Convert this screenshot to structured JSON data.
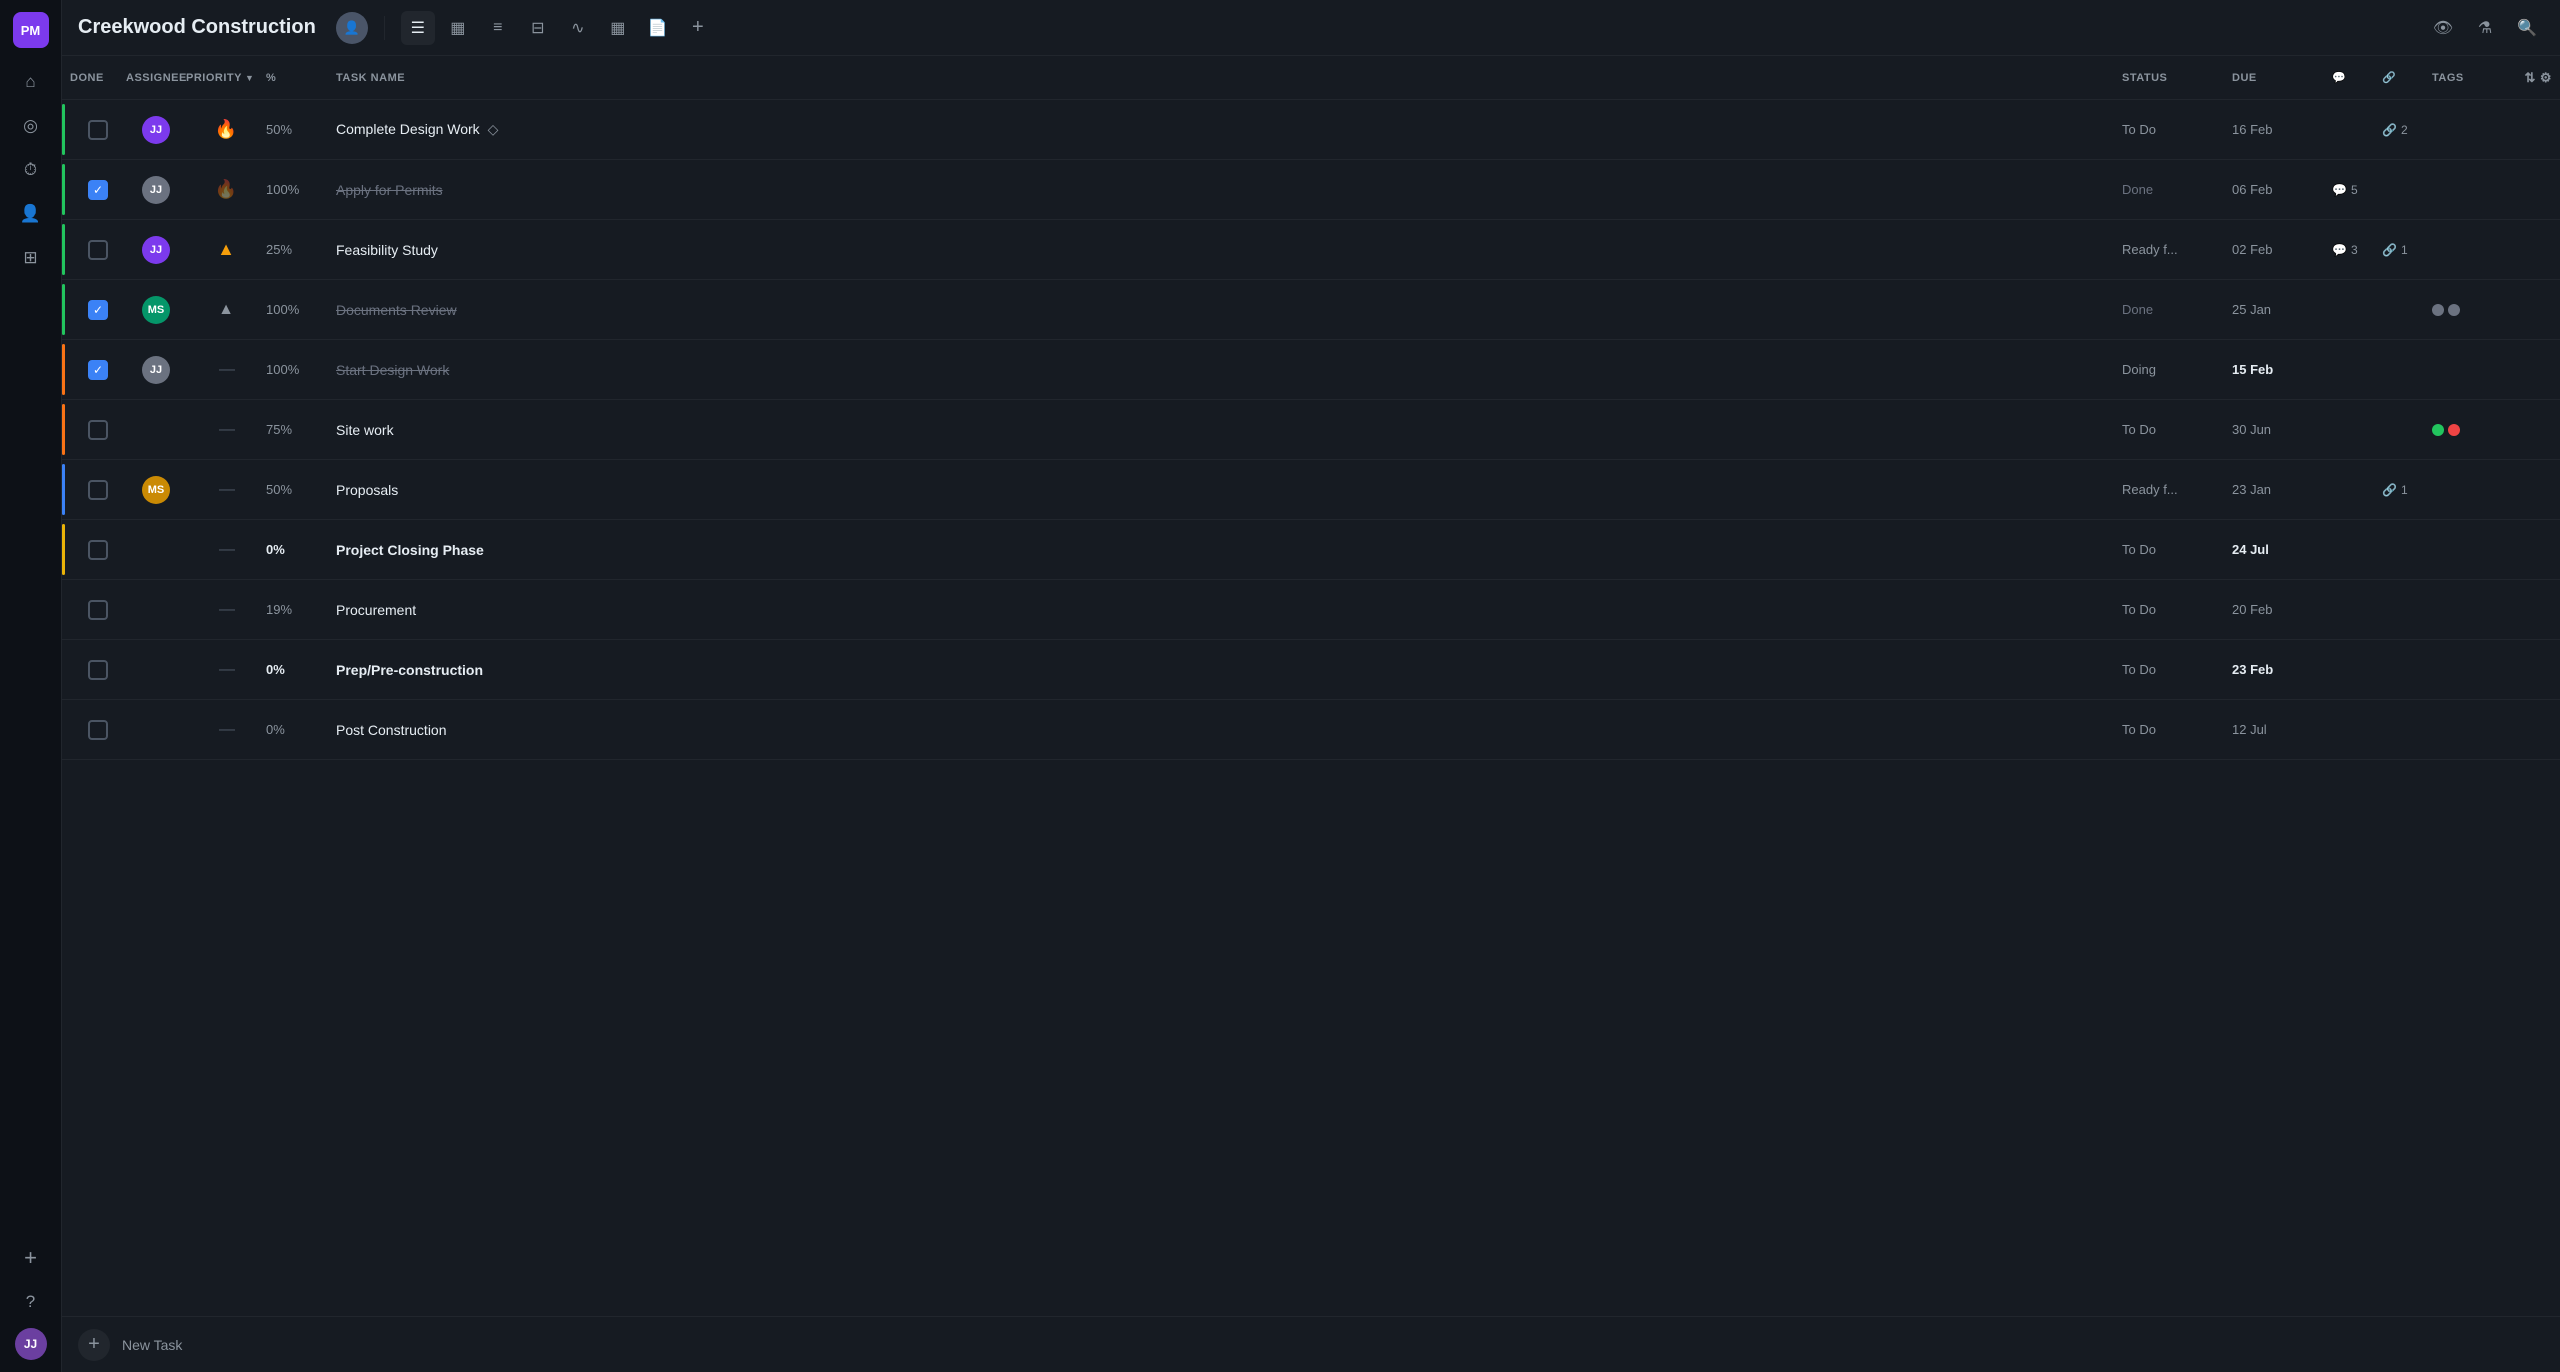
{
  "app": {
    "logo": "PM",
    "title": "Creekwood Construction"
  },
  "sidebar": {
    "icons": [
      {
        "name": "home-icon",
        "symbol": "⌂"
      },
      {
        "name": "notification-icon",
        "symbol": "🔔"
      },
      {
        "name": "clock-icon",
        "symbol": "⏱"
      },
      {
        "name": "people-icon",
        "symbol": "👥"
      },
      {
        "name": "briefcase-icon",
        "symbol": "💼"
      }
    ],
    "bottom_icons": [
      {
        "name": "add-icon",
        "symbol": "+"
      },
      {
        "name": "help-icon",
        "symbol": "?"
      }
    ],
    "user_initials": "JJ"
  },
  "toolbar": {
    "tools": [
      {
        "name": "list-view-btn",
        "symbol": "≡",
        "active": true
      },
      {
        "name": "bar-chart-btn",
        "symbol": "▦",
        "active": false
      },
      {
        "name": "menu-btn",
        "symbol": "≡",
        "active": false
      },
      {
        "name": "table-btn",
        "symbol": "⊞",
        "active": false
      },
      {
        "name": "wave-btn",
        "symbol": "∿",
        "active": false
      },
      {
        "name": "calendar-btn",
        "symbol": "📅",
        "active": false
      },
      {
        "name": "doc-btn",
        "symbol": "📄",
        "active": false
      },
      {
        "name": "plus-btn",
        "symbol": "+",
        "active": false
      }
    ],
    "right_tools": [
      {
        "name": "eye-btn",
        "symbol": "👁"
      },
      {
        "name": "filter-btn",
        "symbol": "⚗"
      },
      {
        "name": "search-btn",
        "symbol": "🔍"
      }
    ]
  },
  "columns": {
    "done": "DONE",
    "assignee": "ASSIGNEE",
    "priority": "PRIORITY",
    "percent": "%",
    "task_name": "TASK NAME",
    "status": "STATUS",
    "due": "DUE",
    "comments": "",
    "links": "",
    "tags": "TAGS"
  },
  "tasks": [
    {
      "id": 1,
      "done": false,
      "assignee": "JJ",
      "assignee_color": "#7c3aed",
      "priority": "fire",
      "percent": "50%",
      "percent_bold": false,
      "task_name": "Complete Design Work",
      "task_name_done": false,
      "task_name_bold": false,
      "has_diamond": true,
      "status": "To Do",
      "status_done": false,
      "due": "16 Feb",
      "due_bold": false,
      "comments": "",
      "links": "2",
      "tags": [],
      "accent": "green"
    },
    {
      "id": 2,
      "done": true,
      "assignee": "JJ",
      "assignee_color": "#6b7280",
      "priority": "fire_dim",
      "percent": "100%",
      "percent_bold": false,
      "task_name": "Apply for Permits",
      "task_name_done": true,
      "task_name_bold": false,
      "has_diamond": false,
      "status": "Done",
      "status_done": true,
      "due": "06 Feb",
      "due_bold": false,
      "comments": "5",
      "links": "",
      "tags": [],
      "accent": "green"
    },
    {
      "id": 3,
      "done": false,
      "assignee": "JJ",
      "assignee_color": "#7c3aed",
      "priority": "up",
      "percent": "25%",
      "percent_bold": false,
      "task_name": "Feasibility Study",
      "task_name_done": false,
      "task_name_bold": false,
      "has_diamond": false,
      "status": "Ready f...",
      "status_done": false,
      "due": "02 Feb",
      "due_bold": false,
      "comments": "3",
      "links": "1",
      "tags": [],
      "accent": "green"
    },
    {
      "id": 4,
      "done": true,
      "assignee": "MS",
      "assignee_color": "#059669",
      "priority": "medium",
      "percent": "100%",
      "percent_bold": false,
      "task_name": "Documents Review",
      "task_name_done": true,
      "task_name_bold": false,
      "has_diamond": false,
      "status": "Done",
      "status_done": true,
      "due": "25 Jan",
      "due_bold": false,
      "comments": "",
      "links": "",
      "tags": [
        "#6b7280",
        "#6b7280"
      ],
      "accent": "green"
    },
    {
      "id": 5,
      "done": true,
      "assignee": "JJ",
      "assignee_color": "#6b7280",
      "priority": "low",
      "percent": "100%",
      "percent_bold": false,
      "task_name": "Start Design Work",
      "task_name_done": true,
      "task_name_bold": false,
      "has_diamond": false,
      "status": "Doing",
      "status_done": false,
      "due": "15 Feb",
      "due_bold": true,
      "comments": "",
      "links": "",
      "tags": [],
      "accent": "orange"
    },
    {
      "id": 6,
      "done": false,
      "assignee": "",
      "assignee_color": "",
      "priority": "low",
      "percent": "75%",
      "percent_bold": false,
      "task_name": "Site work",
      "task_name_done": false,
      "task_name_bold": false,
      "has_diamond": false,
      "status": "To Do",
      "status_done": false,
      "due": "30 Jun",
      "due_bold": false,
      "comments": "",
      "links": "",
      "tags": [
        "#22c55e",
        "#ef4444"
      ],
      "accent": "orange"
    },
    {
      "id": 7,
      "done": false,
      "assignee": "MS",
      "assignee_color": "#ca8a04",
      "priority": "low",
      "percent": "50%",
      "percent_bold": false,
      "task_name": "Proposals",
      "task_name_done": false,
      "task_name_bold": false,
      "has_diamond": false,
      "status": "Ready f...",
      "status_done": false,
      "due": "23 Jan",
      "due_bold": false,
      "comments": "",
      "links": "1",
      "tags": [],
      "accent": "blue"
    },
    {
      "id": 8,
      "done": false,
      "assignee": "",
      "assignee_color": "",
      "priority": "low",
      "percent": "0%",
      "percent_bold": true,
      "task_name": "Project Closing Phase",
      "task_name_done": false,
      "task_name_bold": true,
      "has_diamond": false,
      "status": "To Do",
      "status_done": false,
      "due": "24 Jul",
      "due_bold": true,
      "comments": "",
      "links": "",
      "tags": [],
      "accent": "yellow"
    },
    {
      "id": 9,
      "done": false,
      "assignee": "",
      "assignee_color": "",
      "priority": "low",
      "percent": "19%",
      "percent_bold": false,
      "task_name": "Procurement",
      "task_name_done": false,
      "task_name_bold": false,
      "has_diamond": false,
      "status": "To Do",
      "status_done": false,
      "due": "20 Feb",
      "due_bold": false,
      "comments": "",
      "links": "",
      "tags": [],
      "accent": "none"
    },
    {
      "id": 10,
      "done": false,
      "assignee": "",
      "assignee_color": "",
      "priority": "low",
      "percent": "0%",
      "percent_bold": true,
      "task_name": "Prep/Pre-construction",
      "task_name_done": false,
      "task_name_bold": true,
      "has_diamond": false,
      "status": "To Do",
      "status_done": false,
      "due": "23 Feb",
      "due_bold": true,
      "comments": "",
      "links": "",
      "tags": [],
      "accent": "none"
    },
    {
      "id": 11,
      "done": false,
      "assignee": "",
      "assignee_color": "",
      "priority": "low",
      "percent": "0%",
      "percent_bold": false,
      "task_name": "Post Construction",
      "task_name_done": false,
      "task_name_bold": false,
      "has_diamond": false,
      "status": "To Do",
      "status_done": false,
      "due": "12 Jul",
      "due_bold": false,
      "comments": "",
      "links": "",
      "tags": [],
      "accent": "none"
    }
  ],
  "footer": {
    "add_btn": "+",
    "new_task_label": "New Task"
  }
}
